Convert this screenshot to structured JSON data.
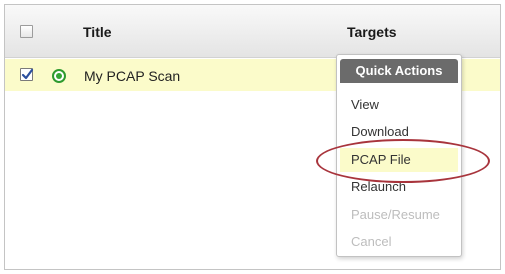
{
  "table": {
    "columns": {
      "title": "Title",
      "targets": "Targets"
    },
    "rows": [
      {
        "title": "My PCAP Scan",
        "checked": true,
        "status": "running"
      }
    ]
  },
  "quick_actions": {
    "header": "Quick Actions",
    "items": [
      {
        "label": "View",
        "enabled": true
      },
      {
        "label": "Download",
        "enabled": true
      },
      {
        "label": "PCAP File",
        "enabled": true,
        "highlighted": true
      },
      {
        "label": "Relaunch",
        "enabled": true
      },
      {
        "label": "Pause/Resume",
        "enabled": false
      },
      {
        "label": "Cancel",
        "enabled": false
      }
    ]
  },
  "colors": {
    "row_highlight": "#fbfbca",
    "menu_header": "#6b6b6b",
    "status_green": "#33a533",
    "emphasis_oval": "#a8343c",
    "disabled_text": "#bdbdbd"
  }
}
